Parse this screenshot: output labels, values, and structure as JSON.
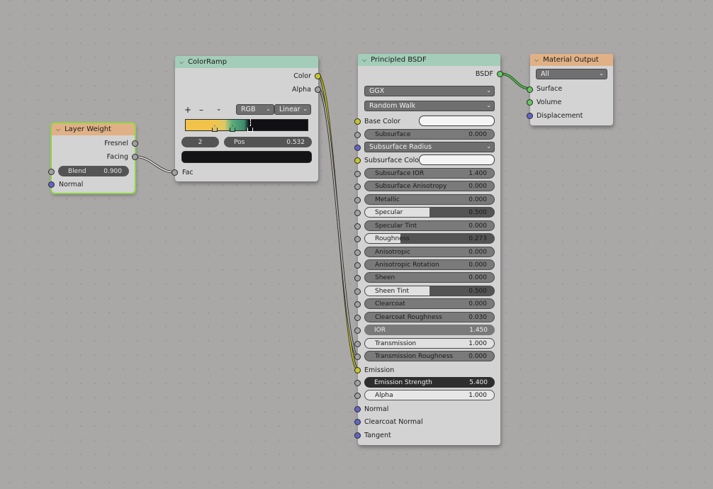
{
  "colors": {
    "canvas": "#aaa7a7",
    "node_body": "#d3d3d3",
    "header_input": "#e0b186",
    "header_converter": "#a3cdb8",
    "header_shader": "#a3cdb8",
    "header_output": "#e0b186",
    "socket_float": "#a1a1a1",
    "socket_color": "#c7c729",
    "socket_vector": "#6363c7",
    "socket_shader": "#63c763",
    "selection": "#8cd34a"
  },
  "layer_weight": {
    "title": "Layer Weight",
    "outputs": [
      "Fresnel",
      "Facing"
    ],
    "blend": {
      "label": "Blend",
      "value": "0.900"
    },
    "normal_label": "Normal"
  },
  "color_ramp": {
    "title": "ColorRamp",
    "outputs": [
      "Color",
      "Alpha"
    ],
    "add_icon": "plus-icon",
    "remove_icon": "minus-icon",
    "menu_icon": "chevron-down-icon",
    "color_mode": "RGB",
    "interpolation": "Linear",
    "active_index": "2",
    "pos": {
      "label": "Pos",
      "value": "0.532"
    },
    "fac_label": "Fac"
  },
  "principled": {
    "title": "Principled BSDF",
    "output": "BSDF",
    "distribution": "GGX",
    "subsurface_method": "Random Walk",
    "base_color_label": "Base Color",
    "subsurface_radius": "Subsurface Radius",
    "subsurface_color_label": "Subsurface Color",
    "fields": [
      {
        "label": "Subsurface",
        "value": "0.000"
      },
      {
        "label": "Subsurface IOR",
        "value": "1.400"
      },
      {
        "label": "Subsurface Anisotropy",
        "value": "0.000"
      },
      {
        "label": "Metallic",
        "value": "0.000"
      },
      {
        "label": "Specular",
        "value": "0.500"
      },
      {
        "label": "Specular Tint",
        "value": "0.000"
      },
      {
        "label": "Roughness",
        "value": "0.273"
      },
      {
        "label": "Anisotropic",
        "value": "0.000"
      },
      {
        "label": "Anisotropic Rotation",
        "value": "0.000"
      },
      {
        "label": "Sheen",
        "value": "0.000"
      },
      {
        "label": "Sheen Tint",
        "value": "0.500"
      },
      {
        "label": "Clearcoat",
        "value": "0.000"
      },
      {
        "label": "Clearcoat Roughness",
        "value": "0.030"
      },
      {
        "label": "IOR",
        "value": "1.450"
      },
      {
        "label": "Transmission",
        "value": "1.000"
      },
      {
        "label": "Transmission Roughness",
        "value": "0.000"
      }
    ],
    "emission_label": "Emission",
    "emission_strength": {
      "label": "Emission Strength",
      "value": "5.400"
    },
    "alpha": {
      "label": "Alpha",
      "value": "1.000"
    },
    "vectors": [
      "Normal",
      "Clearcoat Normal",
      "Tangent"
    ]
  },
  "material_output": {
    "title": "Material Output",
    "target": "All",
    "inputs": [
      "Surface",
      "Volume",
      "Displacement"
    ]
  }
}
